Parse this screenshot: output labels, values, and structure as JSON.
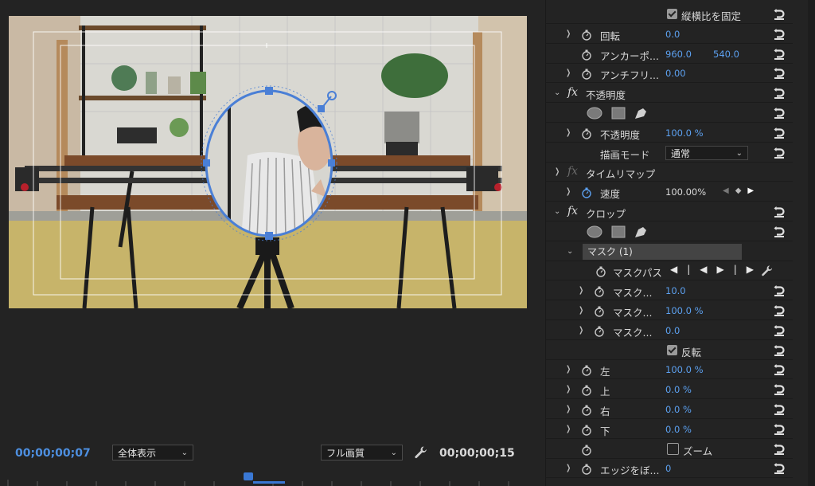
{
  "monitor": {
    "timecode_current": "00;00;00;07",
    "timecode_duration": "00;00;00;15",
    "zoom": "全体表示",
    "quality": "フル画質"
  },
  "effects": {
    "rows": [
      {
        "type": "checkbox",
        "label": "縦横比を固定",
        "checked": true,
        "indent": 1
      },
      {
        "type": "param",
        "label": "回転",
        "value": "0.0",
        "twirl": true,
        "stopwatch": true
      },
      {
        "type": "param",
        "label": "アンカーポ...",
        "value": "960.0",
        "value2": "540.0",
        "twirl": false,
        "stopwatch": true
      },
      {
        "type": "param",
        "label": "アンチフリ...",
        "value": "0.00",
        "twirl": true,
        "stopwatch": true
      },
      {
        "type": "fx",
        "label": "不透明度",
        "open": true
      },
      {
        "type": "shapes"
      },
      {
        "type": "param",
        "label": "不透明度",
        "value": "100.0 %",
        "twirl": true,
        "stopwatch": true
      },
      {
        "type": "blend",
        "label": "描画モード",
        "value": "通常"
      },
      {
        "type": "fx",
        "label": "タイムリマップ",
        "open": false,
        "dim": true
      },
      {
        "type": "param",
        "label": "速度",
        "value": "100.00%",
        "twirl": true,
        "stopwatch": true,
        "white": true,
        "keynav": true,
        "active": true
      },
      {
        "type": "fx",
        "label": "クロップ",
        "open": true
      },
      {
        "type": "shapes"
      },
      {
        "type": "mask",
        "label": "マスク (1)"
      },
      {
        "type": "maskpath",
        "label": "マスクパス"
      },
      {
        "type": "param",
        "label": "マスク...",
        "value": "10.0",
        "twirl": true,
        "stopwatch": true,
        "indent": 2
      },
      {
        "type": "param",
        "label": "マスク...",
        "value": "100.0 %",
        "twirl": true,
        "stopwatch": true,
        "indent": 2
      },
      {
        "type": "param",
        "label": "マスク...",
        "value": "0.0",
        "twirl": true,
        "stopwatch": true,
        "indent": 2
      },
      {
        "type": "checkbox",
        "label": "反転",
        "checked": true,
        "indent": 1
      },
      {
        "type": "param",
        "label": "左",
        "value": "100.0 %",
        "twirl": true,
        "stopwatch": true
      },
      {
        "type": "param",
        "label": "上",
        "value": "0.0 %",
        "twirl": true,
        "stopwatch": true
      },
      {
        "type": "param",
        "label": "右",
        "value": "0.0 %",
        "twirl": true,
        "stopwatch": true
      },
      {
        "type": "param",
        "label": "下",
        "value": "0.0 %",
        "twirl": true,
        "stopwatch": true
      },
      {
        "type": "zoom",
        "label": "ズーム",
        "checked": false
      },
      {
        "type": "param",
        "label": "エッジをぼ...",
        "value": "0",
        "twirl": true,
        "stopwatch": true
      }
    ]
  },
  "colors": {
    "accent": "#4d8fe0",
    "value": "#5ca0ef",
    "mask": "#4a7fd6"
  }
}
